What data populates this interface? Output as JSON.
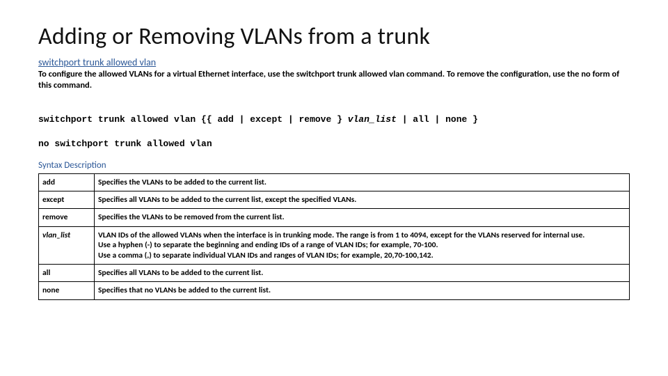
{
  "title": "Adding or Removing VLANs from a trunk",
  "cmd_heading": "switchport trunk allowed vlan",
  "intro": "To configure the allowed VLANs for a virtual Ethernet interface, use the switchport trunk allowed vlan command. To remove the configuration, use the no form of this command.",
  "syntax_line1": "switchport trunk allowed vlan {{ add | except | remove } vlan_list | all | none }",
  "syntax_line2": "no switchport trunk allowed vlan",
  "section_label": "Syntax Description",
  "rows": [
    {
      "key": "add",
      "keyClass": "",
      "desc": "Specifies the VLANs to be added to the current list."
    },
    {
      "key": "except",
      "keyClass": "",
      "desc": "Specifies all VLANs to be added to the current list, except the specified VLANs."
    },
    {
      "key": "remove",
      "keyClass": "",
      "desc": "Specifies the VLANs to be removed from the current list."
    },
    {
      "key": "vlan_list",
      "keyClass": "italic",
      "desc": "VLAN IDs of the allowed VLANs when the interface is in trunking mode. The range is from 1 to 4094, except for the VLANs reserved for internal use.\nUse a hyphen (-) to separate the beginning and ending IDs of a range of VLAN IDs; for example, 70-100.\nUse a comma (,) to separate individual VLAN IDs and ranges of VLAN IDs; for example, 20,70-100,142."
    },
    {
      "key": "all",
      "keyClass": "",
      "desc": "Specifies all VLANs to be added to the current list."
    },
    {
      "key": "none",
      "keyClass": "",
      "desc": "Specifies that no VLANs be added to the current list."
    }
  ]
}
